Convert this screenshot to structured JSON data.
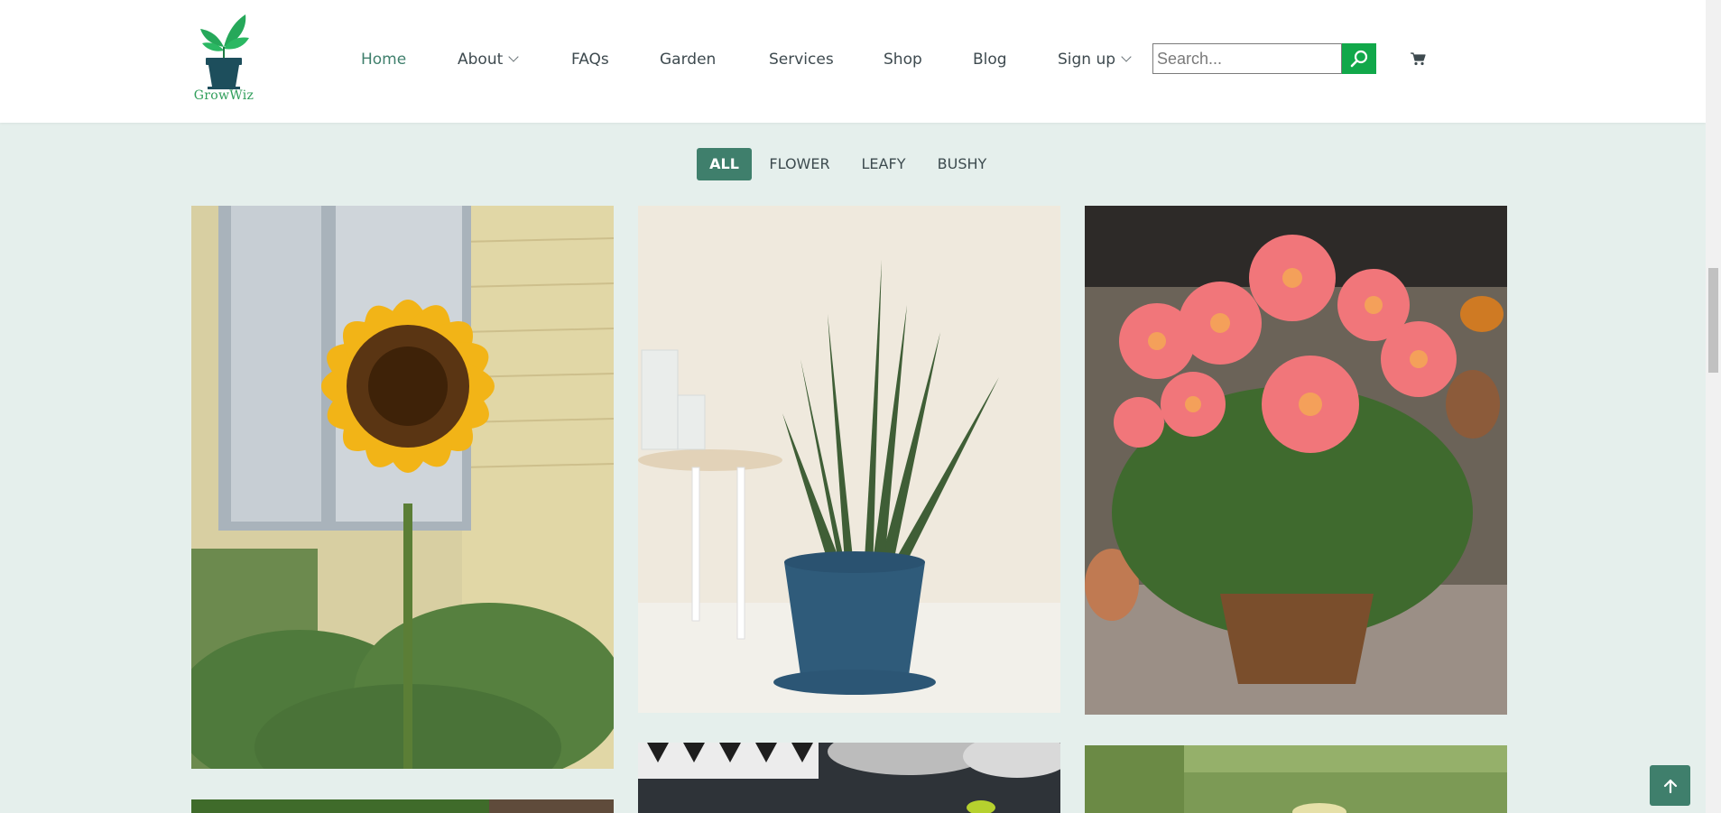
{
  "brand": {
    "name": "GrowWiz",
    "logo_icon": "plant-pot-logo"
  },
  "nav": [
    {
      "label": "Home",
      "active": true,
      "dropdown": false
    },
    {
      "label": "About",
      "active": false,
      "dropdown": true
    },
    {
      "label": "FAQs",
      "active": false,
      "dropdown": false
    },
    {
      "label": "Garden",
      "active": false,
      "dropdown": false
    },
    {
      "label": "Services",
      "active": false,
      "dropdown": false
    },
    {
      "label": "Shop",
      "active": false,
      "dropdown": false
    },
    {
      "label": "Blog",
      "active": false,
      "dropdown": false
    },
    {
      "label": "Sign up",
      "active": false,
      "dropdown": true
    }
  ],
  "search": {
    "placeholder": "Search...",
    "value": "",
    "button_icon": "search-icon"
  },
  "cart": {
    "icon": "cart-icon"
  },
  "filters": [
    {
      "label": "ALL",
      "active": true
    },
    {
      "label": "FLOWER",
      "active": false
    },
    {
      "label": "LEAFY",
      "active": false
    },
    {
      "label": "BUSHY",
      "active": false
    }
  ],
  "gallery": [
    {
      "subject": "sunflower"
    },
    {
      "subject": "snake-plant"
    },
    {
      "subject": "dahlias"
    },
    {
      "subject": "leafy-plant"
    },
    {
      "subject": "plant-on-cushions"
    },
    {
      "subject": "garden-plant"
    }
  ],
  "back_to_top": {
    "icon": "arrow-up-icon"
  },
  "colors": {
    "accent": "#3f7f6c",
    "search_button": "#11a84a",
    "page_bg": "#e5efec"
  }
}
